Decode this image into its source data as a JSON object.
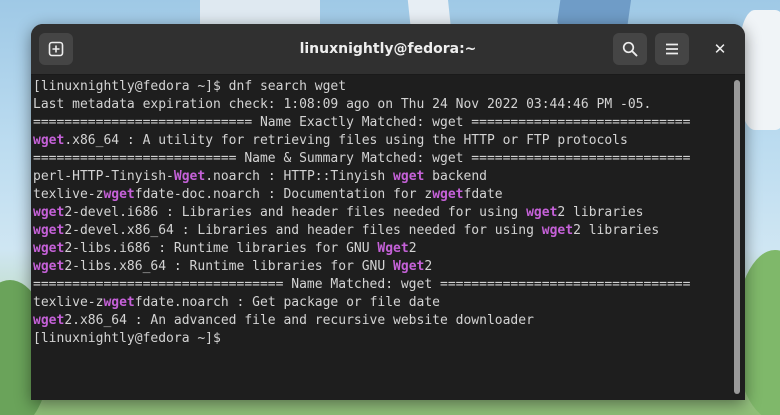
{
  "window": {
    "title": "linuxnightly@fedora:~",
    "new_tab_icon": "plus-in-square-icon",
    "search_icon": "search-icon",
    "menu_icon": "hamburger-menu-icon",
    "close_label": "✕"
  },
  "terminal": {
    "highlight_color": "#c561d8",
    "lines": [
      [
        {
          "t": "[linuxnightly@fedora ~]$ dnf search wget"
        }
      ],
      [
        {
          "t": "Last metadata expiration check: 1:08:09 ago on Thu 24 Nov 2022 03:44:46 PM -05."
        }
      ],
      [
        {
          "t": "============================ Name Exactly Matched: wget ============================"
        }
      ],
      [
        {
          "t": "wget",
          "h": true
        },
        {
          "t": ".x86_64 : A utility for retrieving files using the HTTP or FTP protocols"
        }
      ],
      [
        {
          "t": "========================== Name & Summary Matched: wget ============================"
        }
      ],
      [
        {
          "t": "perl-HTTP-Tinyish-"
        },
        {
          "t": "Wget",
          "h": true
        },
        {
          "t": ".noarch : HTTP::Tinyish "
        },
        {
          "t": "wget",
          "h": true
        },
        {
          "t": " backend"
        }
      ],
      [
        {
          "t": "texlive-z"
        },
        {
          "t": "wget",
          "h": true
        },
        {
          "t": "fdate-doc.noarch : Documentation for z"
        },
        {
          "t": "wget",
          "h": true
        },
        {
          "t": "fdate"
        }
      ],
      [
        {
          "t": "wget",
          "h": true
        },
        {
          "t": "2-devel.i686 : Libraries and header files needed for using "
        },
        {
          "t": "wget",
          "h": true
        },
        {
          "t": "2 libraries"
        }
      ],
      [
        {
          "t": "wget",
          "h": true
        },
        {
          "t": "2-devel.x86_64 : Libraries and header files needed for using "
        },
        {
          "t": "wget",
          "h": true
        },
        {
          "t": "2 libraries"
        }
      ],
      [
        {
          "t": "wget",
          "h": true
        },
        {
          "t": "2-libs.i686 : Runtime libraries for GNU "
        },
        {
          "t": "Wget",
          "h": true
        },
        {
          "t": "2"
        }
      ],
      [
        {
          "t": "wget",
          "h": true
        },
        {
          "t": "2-libs.x86_64 : Runtime libraries for GNU "
        },
        {
          "t": "Wget",
          "h": true
        },
        {
          "t": "2"
        }
      ],
      [
        {
          "t": "================================ Name Matched: wget ================================"
        }
      ],
      [
        {
          "t": "texlive-z"
        },
        {
          "t": "wget",
          "h": true
        },
        {
          "t": "fdate.noarch : Get package or file date"
        }
      ],
      [
        {
          "t": "wget",
          "h": true
        },
        {
          "t": "2.x86_64 : An advanced file and recursive website downloader"
        }
      ],
      [
        {
          "t": "[linuxnightly@fedora ~]$ "
        }
      ]
    ]
  }
}
